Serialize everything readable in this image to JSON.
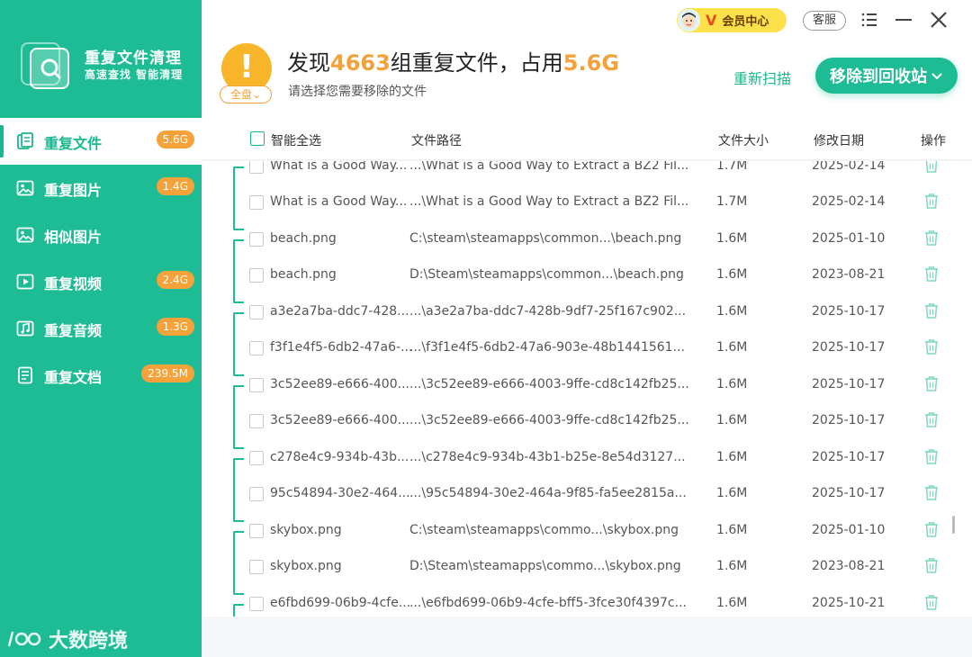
{
  "app": {
    "title": "重复文件清理",
    "subtitle": "高速查找 智能清理"
  },
  "sidebar": {
    "items": [
      {
        "label": "重复文件",
        "badge": "5.6G",
        "active": true
      },
      {
        "label": "重复图片",
        "badge": "1.4G"
      },
      {
        "label": "相似图片",
        "badge": ""
      },
      {
        "label": "重复视频",
        "badge": "2.4G"
      },
      {
        "label": "重复音频",
        "badge": "1.3G"
      },
      {
        "label": "重复文档",
        "badge": "239.5M"
      }
    ]
  },
  "watermark": "大数跨境",
  "header": {
    "warning_icon": "!",
    "scope_label": "全盘",
    "headline_prefix": "发现",
    "group_count": "4663",
    "headline_middle": "组重复文件，占用",
    "total_size": "5.6G",
    "subline": "请选择您需要移除的文件",
    "rescan_label": "重新扫描",
    "recycle_label": "移除到回收站",
    "vip_label": "会员中心",
    "vip_letter": "V",
    "service_label": "客服"
  },
  "table": {
    "columns": {
      "select_all": "智能全选",
      "path": "文件路径",
      "size": "文件大小",
      "date": "修改日期",
      "action": "操作"
    },
    "rows": [
      {
        "name": "What is a Good Way...",
        "path": "...\\What is a Good Way to Extract a BZ2 Fil...",
        "size": "1.7M",
        "date": "2025-02-14"
      },
      {
        "name": "What is a Good Way...",
        "path": "...\\What is a Good Way to Extract a BZ2 Fil...",
        "size": "1.7M",
        "date": "2025-02-14"
      },
      {
        "name": "beach.png",
        "path": "C:\\steam\\steamapps\\common...\\beach.png",
        "size": "1.6M",
        "date": "2025-01-10"
      },
      {
        "name": "beach.png",
        "path": "D:\\Steam\\steamapps\\common...\\beach.png",
        "size": "1.6M",
        "date": "2023-08-21"
      },
      {
        "name": "a3e2a7ba-ddc7-428...",
        "path": "...\\a3e2a7ba-ddc7-428b-9df7-25f167c902...",
        "size": "1.6M",
        "date": "2025-10-17"
      },
      {
        "name": "f3f1e4f5-6db2-47a6-...",
        "path": "...\\f3f1e4f5-6db2-47a6-903e-48b1441561...",
        "size": "1.6M",
        "date": "2025-10-17"
      },
      {
        "name": "3c52ee89-e666-400...",
        "path": "...\\3c52ee89-e666-4003-9ffe-cd8c142fb25...",
        "size": "1.6M",
        "date": "2025-10-17"
      },
      {
        "name": "3c52ee89-e666-400...",
        "path": "...\\3c52ee89-e666-4003-9ffe-cd8c142fb25...",
        "size": "1.6M",
        "date": "2025-10-17"
      },
      {
        "name": "c278e4c9-934b-43b...",
        "path": "...\\c278e4c9-934b-43b1-b25e-8e54d3127...",
        "size": "1.6M",
        "date": "2025-10-17"
      },
      {
        "name": "95c54894-30e2-464...",
        "path": "...\\95c54894-30e2-464a-9f85-fa5ee2815a...",
        "size": "1.6M",
        "date": "2025-10-17"
      },
      {
        "name": "skybox.png",
        "path": "C:\\steam\\steamapps\\commo...\\skybox.png",
        "size": "1.6M",
        "date": "2025-01-10"
      },
      {
        "name": "skybox.png",
        "path": "D:\\Steam\\steamapps\\commo...\\skybox.png",
        "size": "1.6M",
        "date": "2023-08-21"
      },
      {
        "name": "e6fbd699-06b9-4cfe...",
        "path": "...\\e6fbd699-06b9-4cfe-bff5-3fce30f4397c...",
        "size": "1.6M",
        "date": "2025-10-21"
      }
    ]
  },
  "colors": {
    "brand": "#1ebc94",
    "accent": "#f3a13a",
    "badge": "#f6a23a",
    "vip": "#fde14a"
  },
  "icons": [
    "search-icon",
    "file-icon",
    "image-icon",
    "video-icon",
    "audio-icon",
    "document-icon",
    "trash-icon",
    "menu-icon",
    "minimize-icon",
    "close-icon",
    "chevron-down-icon"
  ]
}
